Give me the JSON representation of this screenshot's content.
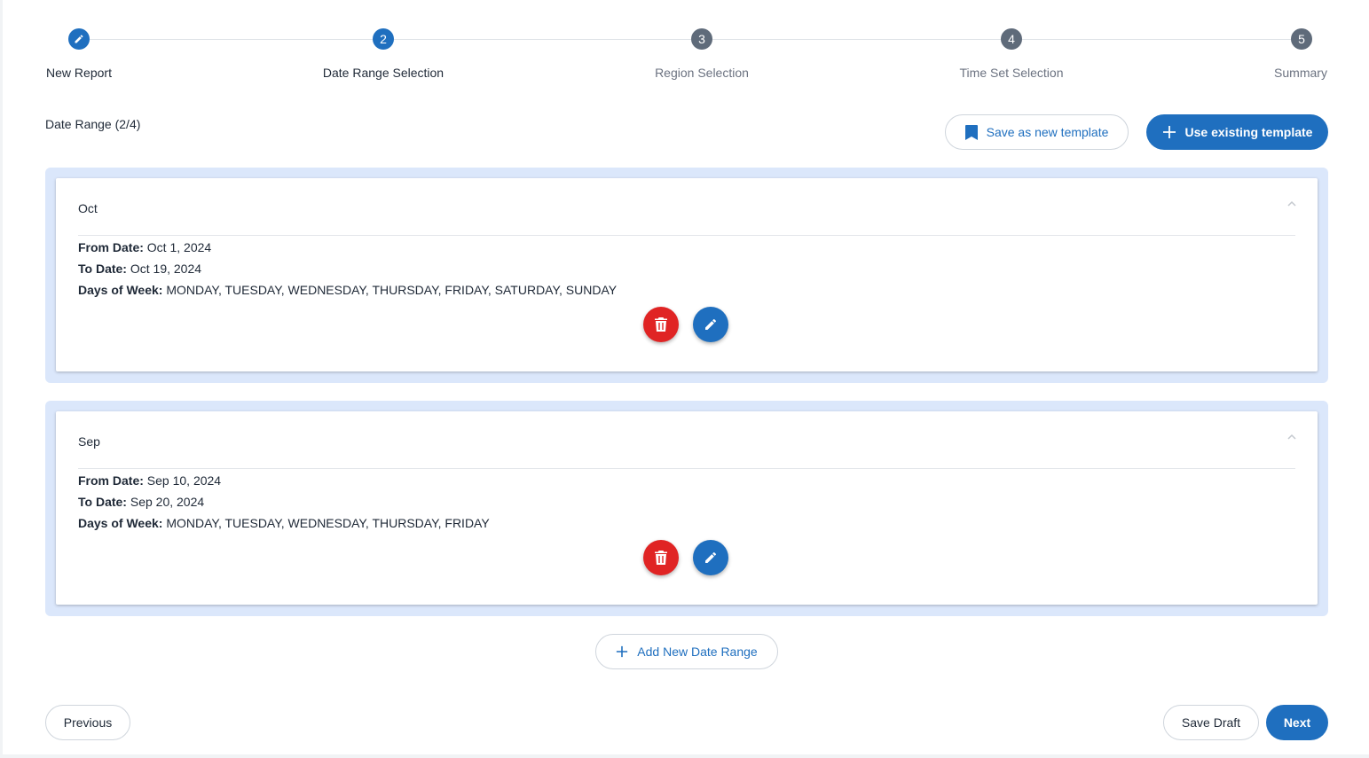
{
  "stepper": {
    "steps": [
      {
        "label": "New Report",
        "number": "",
        "state": "done"
      },
      {
        "label": "Date Range Selection",
        "number": "2",
        "state": "current"
      },
      {
        "label": "Region Selection",
        "number": "3",
        "state": "pending"
      },
      {
        "label": "Time Set Selection",
        "number": "4",
        "state": "pending"
      },
      {
        "label": "Summary",
        "number": "5",
        "state": "pending"
      }
    ]
  },
  "section": {
    "title": "Date Range (2/4)"
  },
  "templates": {
    "save_label": "Save as new template",
    "use_label": "Use existing template"
  },
  "date_ranges": [
    {
      "title": "Oct",
      "from_label": "From Date:",
      "from_value": "Oct 1, 2024",
      "to_label": "To Date:",
      "to_value": "Oct 19, 2024",
      "days_label": "Days of Week:",
      "days_value": "MONDAY, TUESDAY, WEDNESDAY, THURSDAY, FRIDAY, SATURDAY, SUNDAY"
    },
    {
      "title": "Sep",
      "from_label": "From Date:",
      "from_value": "Sep 10, 2024",
      "to_label": "To Date:",
      "to_value": "Sep 20, 2024",
      "days_label": "Days of Week:",
      "days_value": "MONDAY, TUESDAY, WEDNESDAY, THURSDAY, FRIDAY"
    }
  ],
  "add_range": {
    "label": "Add New Date Range"
  },
  "footer": {
    "previous_label": "Previous",
    "save_draft_label": "Save Draft",
    "next_label": "Next"
  },
  "colors": {
    "primary": "#1f6fbf",
    "danger": "#e02424",
    "card_bg": "#dbe7fb",
    "step_pending": "#5f6b7a"
  },
  "icons": {
    "step1": "pencil-icon",
    "save_template": "bookmark-icon",
    "use_template": "plus-icon",
    "delete": "trash-icon",
    "edit": "pencil-icon",
    "collapse": "chevron-up-icon",
    "add": "plus-icon"
  }
}
